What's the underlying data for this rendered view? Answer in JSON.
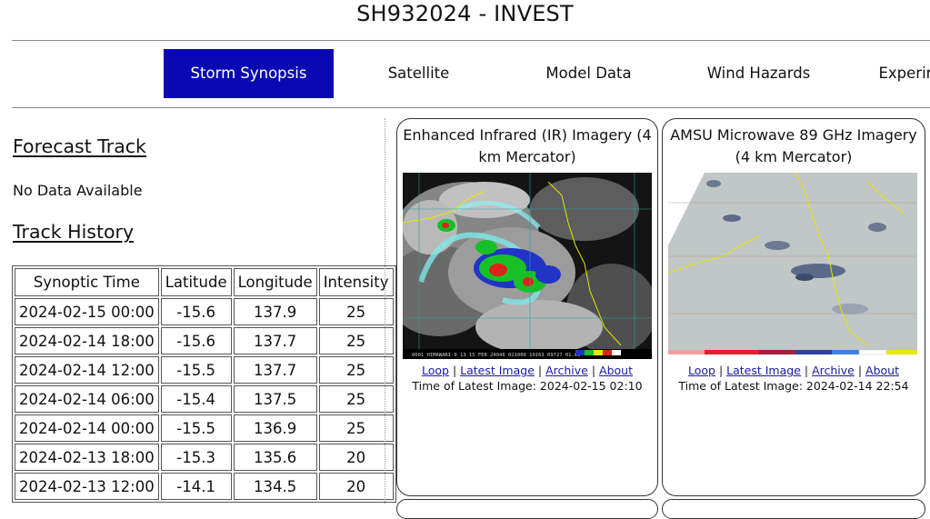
{
  "title": "SH932024 - INVEST",
  "tabs": [
    {
      "label": "Storm Synopsis",
      "active": true
    },
    {
      "label": "Satellite",
      "active": false
    },
    {
      "label": "Model Data",
      "active": false
    },
    {
      "label": "Wind Hazards",
      "active": false
    },
    {
      "label": "Experimental",
      "active": false
    }
  ],
  "forecast": {
    "heading": "Forecast Track",
    "message": "No Data Available"
  },
  "history": {
    "heading": "Track History",
    "columns": [
      "Synoptic Time",
      "Latitude",
      "Longitude",
      "Intensity"
    ],
    "rows": [
      [
        "2024-02-15 00:00",
        "-15.6",
        "137.9",
        "25"
      ],
      [
        "2024-02-14 18:00",
        "-15.6",
        "137.7",
        "25"
      ],
      [
        "2024-02-14 12:00",
        "-15.5",
        "137.7",
        "25"
      ],
      [
        "2024-02-14 06:00",
        "-15.4",
        "137.5",
        "25"
      ],
      [
        "2024-02-14 00:00",
        "-15.5",
        "136.9",
        "25"
      ],
      [
        "2024-02-13 18:00",
        "-15.3",
        "135.6",
        "20"
      ],
      [
        "2024-02-13 12:00",
        "-14.1",
        "134.5",
        "20"
      ]
    ]
  },
  "cards": {
    "ir": {
      "title": "Enhanced Infrared (IR) Imagery (4 km Mercator)",
      "links": [
        "Loop",
        "Latest Image",
        "Archive",
        "About"
      ],
      "time_label": "Time of Latest Image: 2024-02-15 02:10",
      "image_caption": "0001 HIMAWARI-9 13 15 FEB 24046 021000 10163 09727 01.00"
    },
    "mw": {
      "title": "AMSU Microwave 89 GHz Imagery (4 km Mercator)",
      "links": [
        "Loop",
        "Latest Image",
        "Archive",
        "About"
      ],
      "time_label": "Time of Latest Image: 2024-02-14 22:54"
    }
  },
  "colors": {
    "active_tab": "#0a08b4",
    "link": "#1a1aa6"
  }
}
